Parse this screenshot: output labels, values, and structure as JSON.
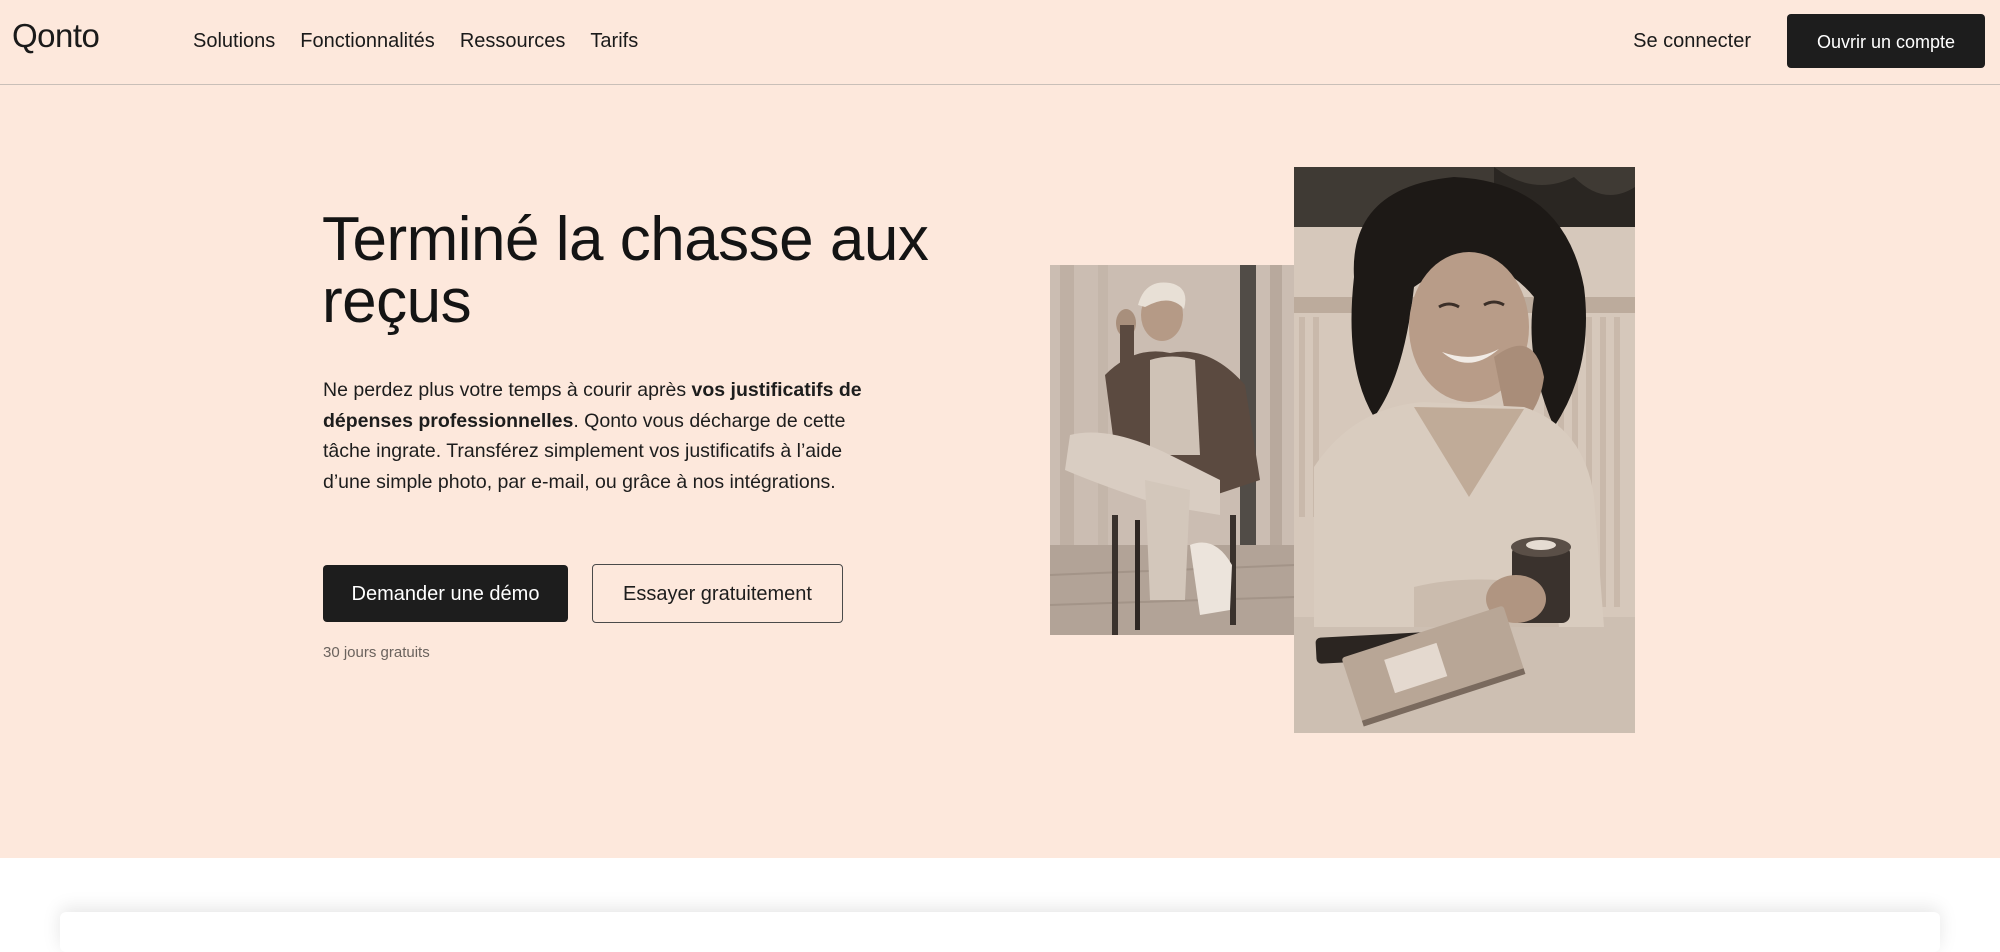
{
  "header": {
    "logo": "Qonto",
    "nav": [
      {
        "label": "Solutions"
      },
      {
        "label": "Fonctionnalités"
      },
      {
        "label": "Ressources"
      },
      {
        "label": "Tarifs"
      }
    ],
    "login_label": "Se connecter",
    "open_account_label": "Ouvrir un compte"
  },
  "hero": {
    "title_line1": "Terminé la chasse aux",
    "title_line2": "reçus",
    "desc_part1": "Ne perdez plus votre temps à courir après ",
    "desc_bold": "vos justificatifs de dépenses professionnelles",
    "desc_part2": ". Qonto vous décharge de cette tâche ingrate. Transférez simplement vos justificatifs à l’aide d’une simple photo, par e-mail, ou grâce à nos intégrations.",
    "demo_label": "Demander une démo",
    "trial_label": "Essayer gratuitement",
    "trial_note": "30 jours gratuits"
  },
  "colors": {
    "hero_background": "#fde8dc",
    "button_dark": "#1d1d1d"
  }
}
